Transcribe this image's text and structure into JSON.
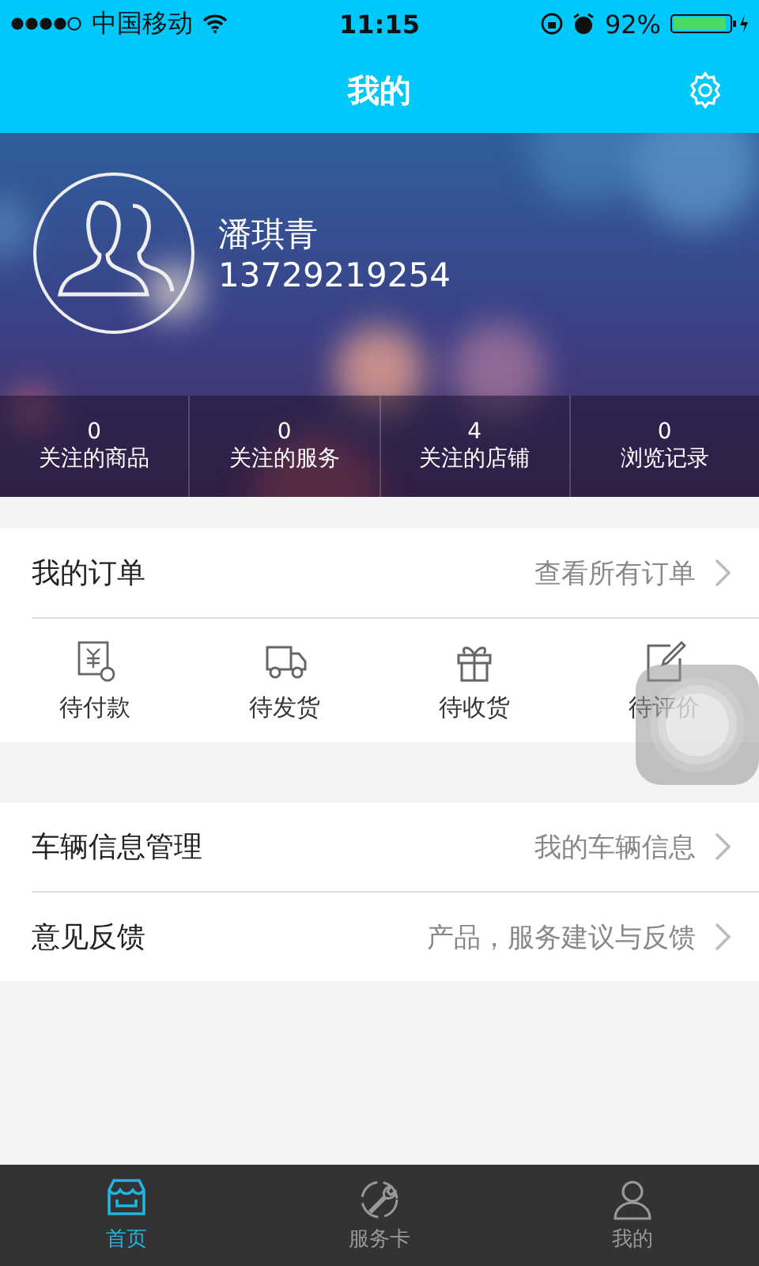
{
  "status_bar": {
    "carrier": "中国移动",
    "time": "11:15",
    "battery": "92%"
  },
  "nav": {
    "title": "我的"
  },
  "profile": {
    "name": "潘琪青",
    "phone": "13729219254",
    "stats": [
      {
        "count": "0",
        "label": "关注的商品"
      },
      {
        "count": "0",
        "label": "关注的服务"
      },
      {
        "count": "4",
        "label": "关注的店铺"
      },
      {
        "count": "0",
        "label": "浏览记录"
      }
    ]
  },
  "orders": {
    "title": "我的订单",
    "link": "查看所有订单",
    "items": [
      {
        "kind": "payment",
        "label": "待付款"
      },
      {
        "kind": "shipping",
        "label": "待发货"
      },
      {
        "kind": "receiving",
        "label": "待收货"
      },
      {
        "kind": "review",
        "label": "待评价"
      }
    ]
  },
  "menu": [
    {
      "label": "车辆信息管理",
      "value": "我的车辆信息"
    },
    {
      "label": "意见反馈",
      "value": "产品，服务建议与反馈"
    }
  ],
  "tabs": [
    {
      "kind": "home",
      "label": "首页",
      "selected": true
    },
    {
      "kind": "service",
      "label": "服务卡",
      "selected": false
    },
    {
      "kind": "profile",
      "label": "我的",
      "selected": false
    }
  ]
}
